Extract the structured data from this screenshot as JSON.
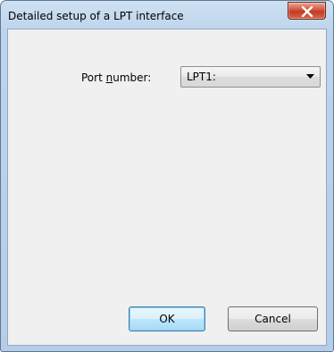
{
  "window": {
    "title": "Detailed setup of a LPT interface"
  },
  "form": {
    "port_label_prefix": "Port ",
    "port_label_accel": "n",
    "port_label_suffix": "umber:",
    "port_value": "LPT1:"
  },
  "buttons": {
    "ok": "OK",
    "cancel": "Cancel"
  },
  "icons": {
    "close": "close-icon",
    "dropdown": "chevron-down-icon"
  },
  "colors": {
    "close_button": "#c94a33",
    "default_button_border": "#3c7fb1",
    "client_background": "#f0f0f0"
  }
}
